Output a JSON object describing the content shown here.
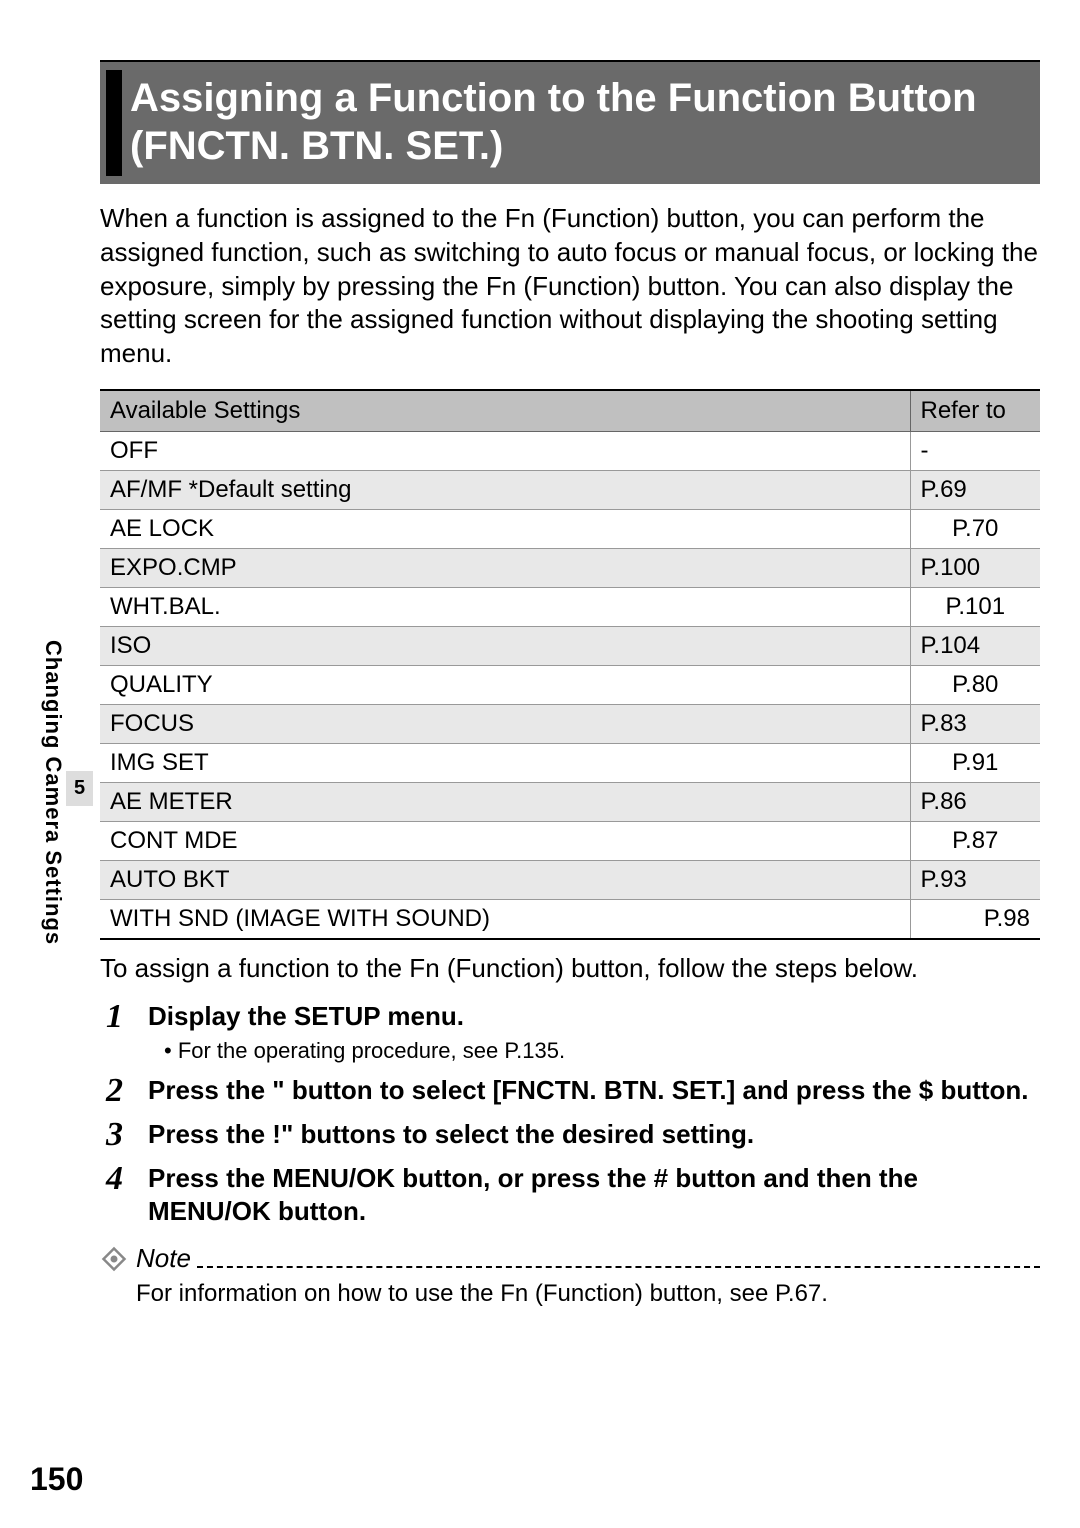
{
  "side": {
    "number": "5",
    "label": "Changing Camera Settings"
  },
  "page_number": "150",
  "title": "Assigning a Function to the Function Button (FNCTN. BTN. SET.)",
  "intro": "When a function is assigned to the Fn (Function) button, you can perform the assigned function, such as switching to auto focus or manual focus, or locking the exposure, simply by pressing the Fn (Function) button. You can also display the setting screen for the assigned function without displaying the shooting setting menu.",
  "table": {
    "header_setting": "Available Settings",
    "header_ref": "Refer to",
    "rows": [
      {
        "setting": "OFF",
        "ref": "-",
        "align": "left"
      },
      {
        "setting": "AF/MF *Default setting",
        "ref": "P.69",
        "align": "left"
      },
      {
        "setting": "AE LOCK",
        "ref": "P.70",
        "align": "center"
      },
      {
        "setting": "EXPO.CMP",
        "ref": "P.100",
        "align": "left"
      },
      {
        "setting": "WHT.BAL.",
        "ref": "P.101",
        "align": "center"
      },
      {
        "setting": "ISO",
        "ref": "P.104",
        "align": "left"
      },
      {
        "setting": "QUALITY",
        "ref": "P.80",
        "align": "center"
      },
      {
        "setting": "FOCUS",
        "ref": "P.83",
        "align": "left"
      },
      {
        "setting": "IMG SET",
        "ref": "P.91",
        "align": "center"
      },
      {
        "setting": "AE METER",
        "ref": "P.86",
        "align": "left"
      },
      {
        "setting": "CONT MDE",
        "ref": "P.87",
        "align": "center"
      },
      {
        "setting": "AUTO BKT",
        "ref": "P.93",
        "align": "left"
      },
      {
        "setting": "WITH SND (IMAGE WITH SOUND)",
        "ref": "P.98",
        "align": "right"
      }
    ]
  },
  "followup": "To assign a function to the Fn (Function) button, follow the steps below.",
  "steps": [
    {
      "num": "1",
      "title": "Display the SETUP menu.",
      "sub": "• For the operating procedure, see P.135."
    },
    {
      "num": "2",
      "title": "Press the \" button to select [FNCTN. BTN. SET.] and press the $ button.",
      "sub": ""
    },
    {
      "num": "3",
      "title": "Press the !\"   buttons to select the desired setting.",
      "sub": ""
    },
    {
      "num": "4",
      "title": "Press the MENU/OK button, or press the # button and then the MENU/OK button.",
      "sub": ""
    }
  ],
  "note": {
    "label": "Note",
    "text": "For information on how to use the Fn (Function) button, see P.67."
  }
}
